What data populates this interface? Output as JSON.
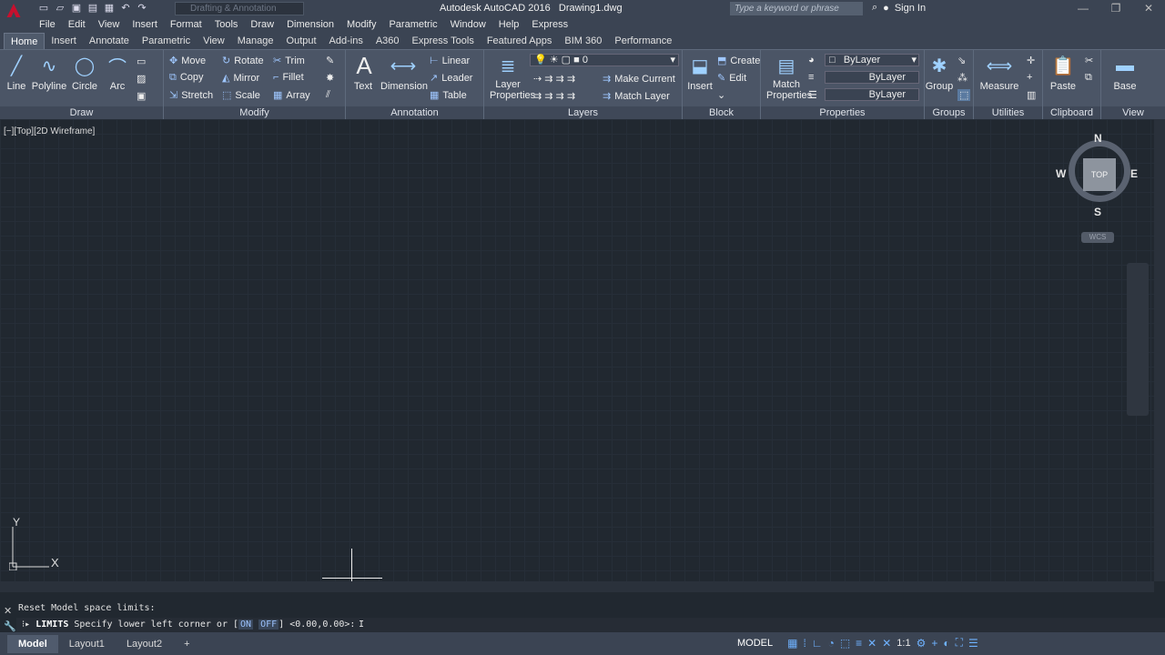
{
  "titlebar": {
    "app_name": "Autodesk AutoCAD 2016",
    "file_name": "Drawing1.dwg",
    "workspace": "Drafting & Annotation",
    "search_placeholder": "Type a keyword or phrase",
    "sign_in": "Sign In"
  },
  "menubar": [
    "File",
    "Edit",
    "View",
    "Insert",
    "Format",
    "Tools",
    "Draw",
    "Dimension",
    "Modify",
    "Parametric",
    "Window",
    "Help",
    "Express"
  ],
  "ribbon_tabs": [
    "Home",
    "Insert",
    "Annotate",
    "Parametric",
    "View",
    "Manage",
    "Output",
    "Add-ins",
    "A360",
    "Express Tools",
    "Featured Apps",
    "BIM 360",
    "Performance"
  ],
  "panels": {
    "draw": {
      "title": "Draw",
      "line": "Line",
      "polyline": "Polyline",
      "circle": "Circle",
      "arc": "Arc"
    },
    "modify": {
      "title": "Modify",
      "move": "Move",
      "rotate": "Rotate",
      "trim": "Trim",
      "copy": "Copy",
      "mirror": "Mirror",
      "fillet": "Fillet",
      "stretch": "Stretch",
      "scale": "Scale",
      "array": "Array"
    },
    "annotation": {
      "title": "Annotation",
      "text": "Text",
      "dimension": "Dimension",
      "linear": "Linear",
      "leader": "Leader",
      "table": "Table"
    },
    "layers": {
      "title": "Layers",
      "layer_properties_1": "Layer",
      "layer_properties_2": "Properties",
      "current_layer": "0",
      "make_current": "Make Current",
      "match_layer": "Match Layer"
    },
    "block": {
      "title": "Block",
      "insert": "Insert",
      "create": "Create",
      "edit": "Edit"
    },
    "properties": {
      "title": "Properties",
      "match_1": "Match",
      "match_2": "Properties",
      "color": "ByLayer",
      "linetype": "ByLayer",
      "lineweight": "ByLayer"
    },
    "groups": {
      "title": "Groups",
      "group": "Group"
    },
    "utilities": {
      "title": "Utilities",
      "measure": "Measure"
    },
    "clipboard": {
      "title": "Clipboard",
      "paste": "Paste"
    },
    "view": {
      "title": "View",
      "base": "Base"
    }
  },
  "viewport": {
    "label": "[−][Top][2D Wireframe]",
    "compass": {
      "n": "N",
      "s": "S",
      "e": "E",
      "w": "W",
      "top": "TOP",
      "wcs": "WCS"
    },
    "ucs_x": "X",
    "ucs_y": "Y"
  },
  "command": {
    "history": "Reset Model space limits:",
    "name": "LIMITS",
    "prompt": "Specify lower left corner or [",
    "opt_on": "ON",
    "opt_off": "OFF",
    "suffix": "] <0.00,0.00>:"
  },
  "status": {
    "tabs": [
      "Model",
      "Layout1",
      "Layout2"
    ],
    "model": "MODEL",
    "scale": "1:1"
  },
  "colors": {
    "accent": "#3b4453",
    "grid": "#303946",
    "background": "#212830"
  }
}
